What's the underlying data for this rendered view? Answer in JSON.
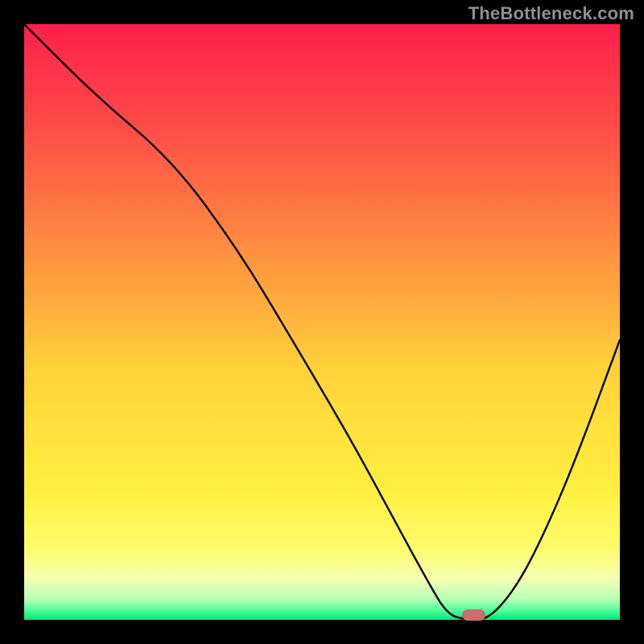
{
  "watermark": "TheBottleneck.com",
  "chart_data": {
    "type": "line",
    "title": "",
    "xlabel": "",
    "ylabel": "",
    "xlim": [
      0,
      100
    ],
    "ylim": [
      0,
      100
    ],
    "grid": false,
    "series": [
      {
        "name": "curve",
        "x": [
          0,
          12,
          25,
          36,
          45,
          55,
          62,
          68,
          71,
          74,
          78,
          83,
          88,
          93,
          100
        ],
        "y": [
          100,
          88,
          77,
          62,
          47,
          30,
          17,
          6,
          1,
          0,
          0,
          6,
          16,
          28,
          47
        ]
      }
    ],
    "optimum_marker": {
      "x": 75.5,
      "y": 0.8,
      "width_pct": 4.0,
      "height_pct": 1.8
    },
    "gradient_stops": [
      {
        "pct": 0,
        "color": "#ff1f4b"
      },
      {
        "pct": 18,
        "color": "#ff4e48"
      },
      {
        "pct": 38,
        "color": "#ff8f3f"
      },
      {
        "pct": 58,
        "color": "#ffd23a"
      },
      {
        "pct": 78,
        "color": "#ffef3f"
      },
      {
        "pct": 88,
        "color": "#fffb6b"
      },
      {
        "pct": 93,
        "color": "#f4ffb0"
      },
      {
        "pct": 96.5,
        "color": "#b8ffb8"
      },
      {
        "pct": 98.2,
        "color": "#5bff9d"
      },
      {
        "pct": 100,
        "color": "#00e57a"
      }
    ]
  }
}
